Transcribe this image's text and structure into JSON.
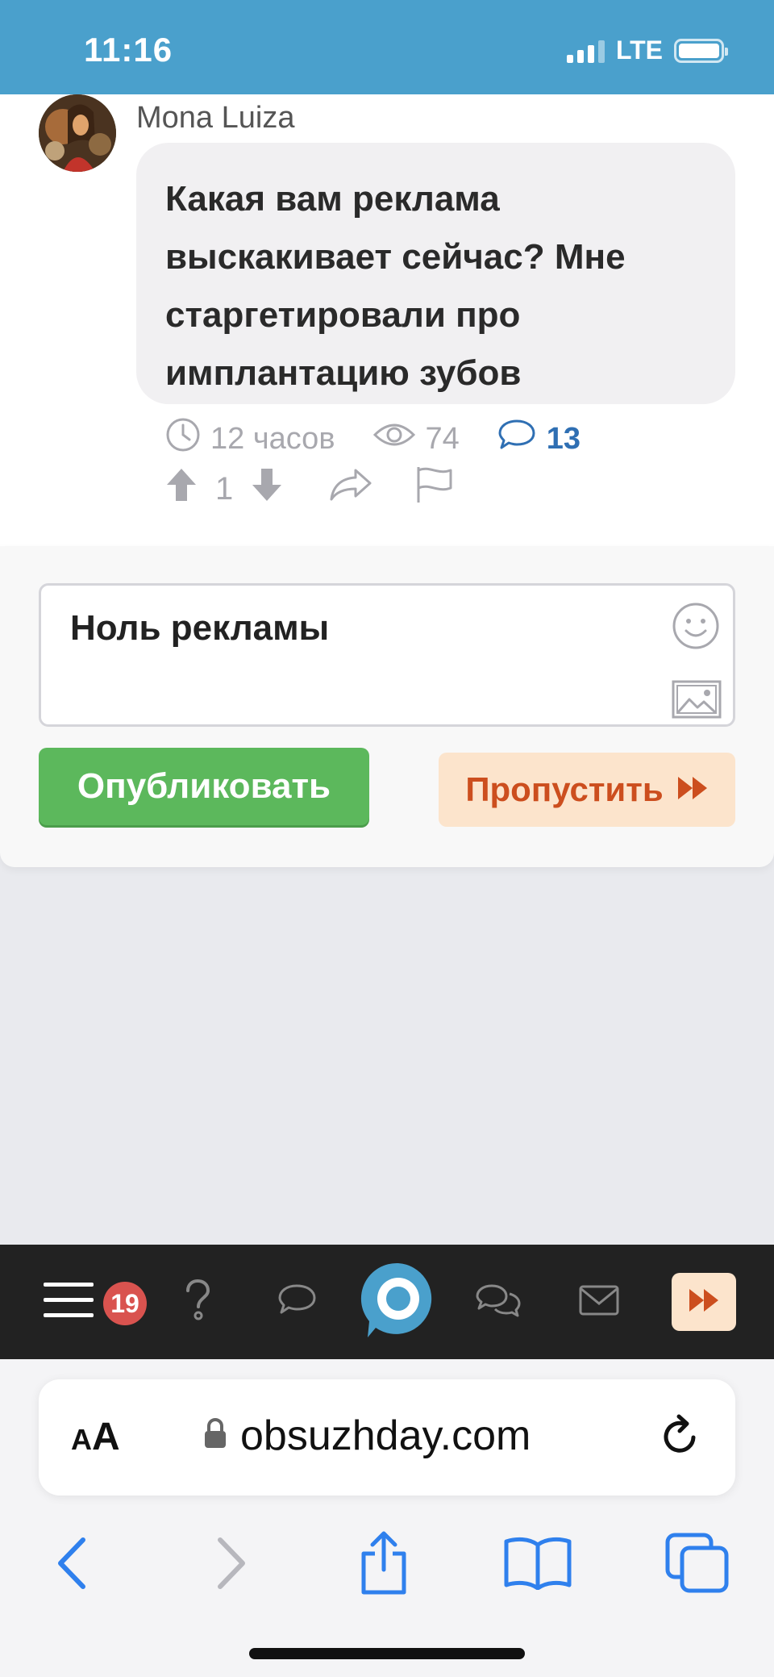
{
  "status_bar": {
    "time": "11:16",
    "network": "LTE"
  },
  "post": {
    "author": "Mona Luiza",
    "text": "Какая вам реклама выскакивает сейчас? Мне старгетировали про имплантацию зубов",
    "time_ago": "12 часов",
    "views": "74",
    "comments": "13",
    "score": "1"
  },
  "reply": {
    "text": "Ноль рекламы",
    "publish_label": "Опубликовать",
    "skip_label": "Пропустить"
  },
  "bottom_nav": {
    "notifications_badge": "19"
  },
  "browser": {
    "text_size_label_small": "A",
    "text_size_label_large": "A",
    "url": "obsuzhday.com"
  },
  "colors": {
    "status_bar": "#4aa0cc",
    "publish": "#5cb85c",
    "skip_bg": "#fce4cc",
    "skip_text": "#cc4e1e",
    "link_blue": "#2f6fb3",
    "badge": "#d9534f",
    "safari_blue": "#2f80ed"
  }
}
